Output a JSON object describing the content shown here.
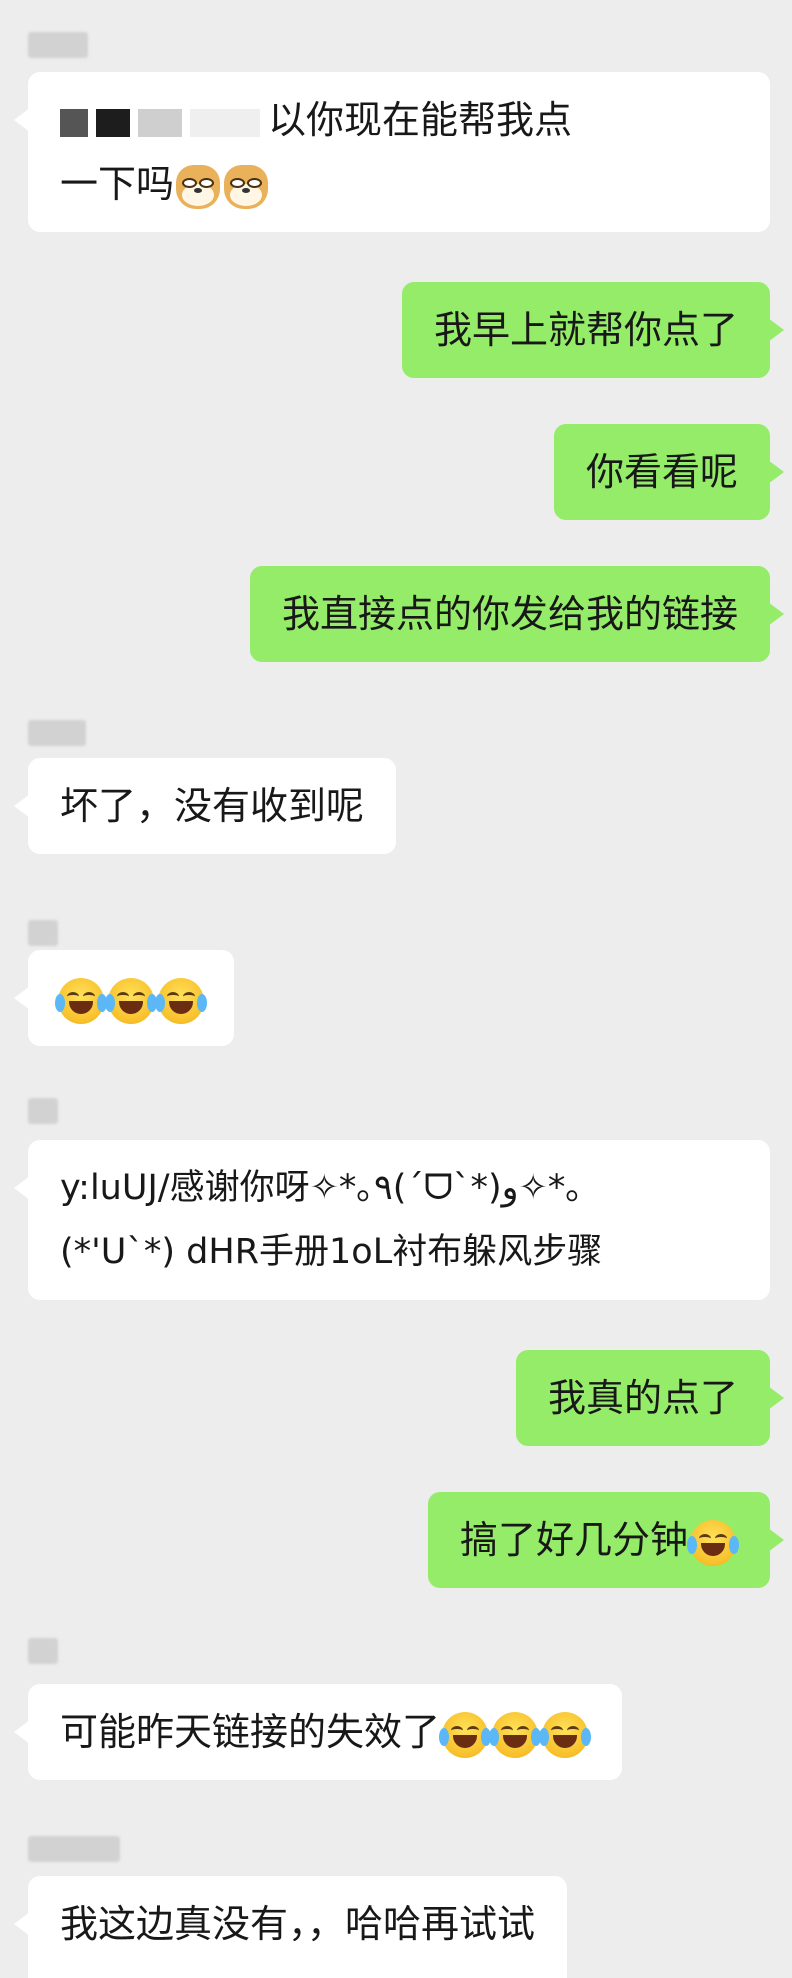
{
  "messages": [
    {
      "id": "m1",
      "from": "other",
      "text_after_redaction": "以你现在能帮我点",
      "line2": "一下吗"
    },
    {
      "id": "m2",
      "from": "me",
      "text": "我早上就帮你点了"
    },
    {
      "id": "m3",
      "from": "me",
      "text": "你看看呢"
    },
    {
      "id": "m4",
      "from": "me",
      "text": "我直接点的你发给我的链接"
    },
    {
      "id": "m5",
      "from": "other",
      "text": "坏了，没有收到呢"
    },
    {
      "id": "m6",
      "from": "other",
      "emojis": [
        "laughing-crying",
        "laughing-crying",
        "laughing-crying"
      ]
    },
    {
      "id": "m7",
      "from": "other",
      "line1": "y:luUJ/感谢你呀✧*｡٩(ˊᗜˋ*)و✧*｡",
      "line2": "(*'U`*) dHR手册1oL衬布躲风步骤"
    },
    {
      "id": "m8",
      "from": "me",
      "text": "我真的点了"
    },
    {
      "id": "m9",
      "from": "me",
      "text": "搞了好几分钟"
    },
    {
      "id": "m10",
      "from": "other",
      "text": "可能昨天链接的失效了"
    },
    {
      "id": "m11",
      "from": "other",
      "text": "我这边真没有，，哈哈再试试"
    }
  ],
  "colors": {
    "background": "#ededed",
    "incoming_bubble": "#ffffff",
    "outgoing_bubble": "#95ec69"
  },
  "icons": {
    "laughing": "laughing-crying-emoji",
    "doge": "doge-emoji"
  }
}
